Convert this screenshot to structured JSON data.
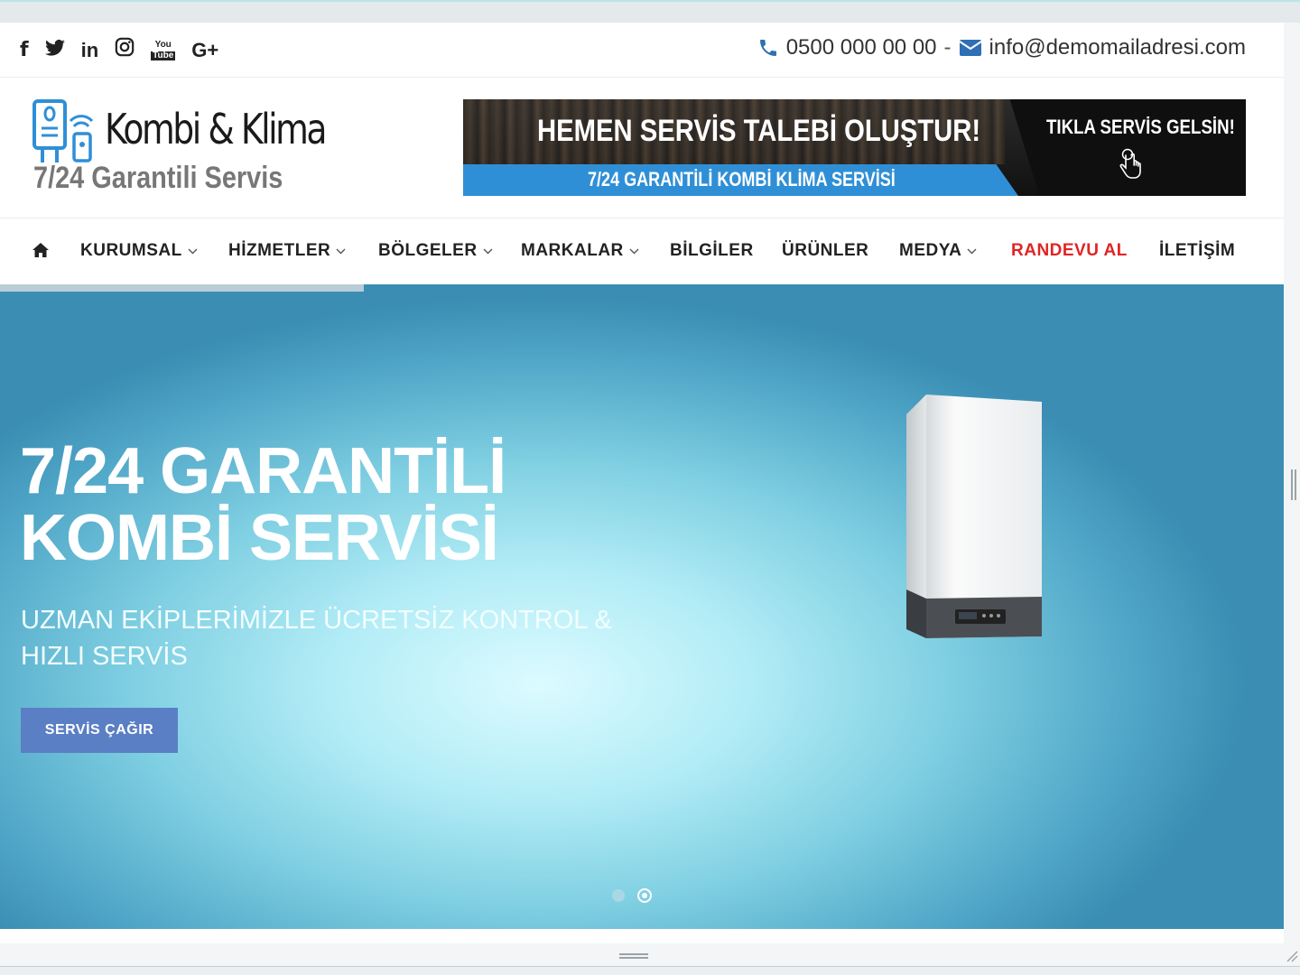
{
  "social": {
    "facebook": "f",
    "twitter": "twitter-icon",
    "linkedin": "in",
    "instagram": "instagram-icon",
    "youtube_top": "You",
    "youtube_bottom": "Tube",
    "googleplus": "G+"
  },
  "contact": {
    "phone": "0500 000 00 00",
    "separator": "-",
    "email": "info@demomailadresi.com"
  },
  "logo": {
    "title": "Kombi & Klima",
    "subtitle": "7/24 Garantili Servis"
  },
  "banner": {
    "headline": "HEMEN SERVİS TALEBİ OLUŞTUR!",
    "subline": "7/24 GARANTİLİ KOMBİ KLİMA SERVİSİ",
    "cta": "TIKLA SERVİS GELSİN!"
  },
  "nav": {
    "items": [
      {
        "label": "KURUMSAL"
      },
      {
        "label": "HİZMETLER"
      },
      {
        "label": "BÖLGELER"
      },
      {
        "label": "MARKALAR"
      },
      {
        "label": "BİLGİLER"
      },
      {
        "label": "ÜRÜNLER"
      },
      {
        "label": "MEDYA"
      },
      {
        "label": "RANDEVU AL"
      },
      {
        "label": "İLETİŞİM"
      }
    ]
  },
  "hero": {
    "title_line1": "7/24 GARANTİLİ",
    "title_line2": "KOMBİ SERVİSİ",
    "subtitle": "UZMAN EKİPLERİMİZLE ÜCRETSİZ KONTROL & HIZLI SERVİS",
    "button": "SERVİS ÇAĞIR",
    "slide_count": 2,
    "active_slide": 2
  },
  "colors": {
    "accent_red": "#e02424",
    "button_blue": "#5b7fc4",
    "icon_blue": "#2f6fb5",
    "banner_blue": "#2f8fd6"
  }
}
